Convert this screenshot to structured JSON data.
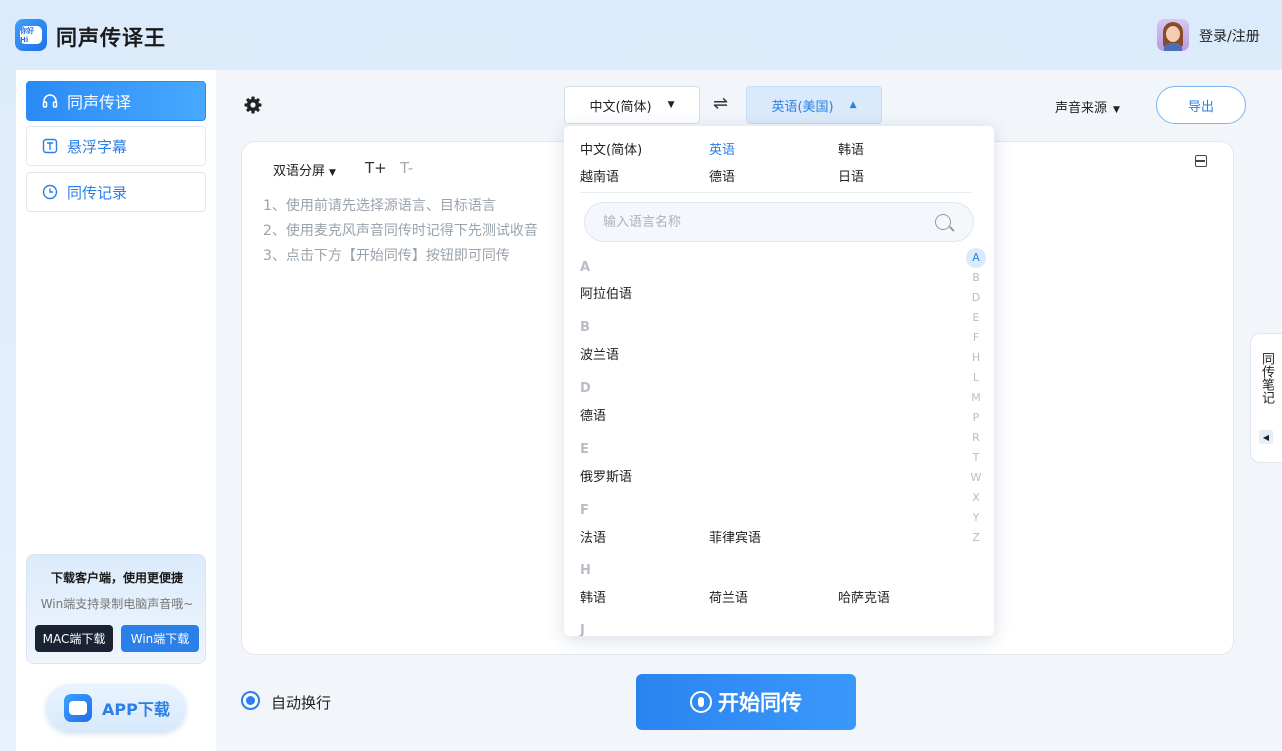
{
  "header": {
    "logo_text": "你好Hi",
    "app_title": "同声传译王",
    "login_label": "登录/注册"
  },
  "sidebar": {
    "items": [
      {
        "label": "同声传译",
        "icon": "headphones-icon",
        "active": true
      },
      {
        "label": "悬浮字幕",
        "icon": "text-box-icon",
        "active": false
      },
      {
        "label": "同传记录",
        "icon": "clock-icon",
        "active": false
      }
    ],
    "promo": {
      "title": "下载客户端，使用更便捷",
      "subtitle": "Win端支持录制电脑声音哦~",
      "mac_button": "MAC端下载",
      "win_button": "Win端下载"
    },
    "app_download_label": "APP下载"
  },
  "toolbar": {
    "source_language": "中文(简体)",
    "target_language": "英语(美国)",
    "voice_source_label": "声音来源",
    "export_label": "导出"
  },
  "panel": {
    "display_mode": "双语分屏",
    "font_increase": "T+",
    "font_decrease": "T-",
    "tips": [
      "1、使用前请先选择源语言、目标语言",
      "2、使用麦克风声音同传时记得下先测试收音",
      "3、点击下方【开始同传】按钮即可同传"
    ]
  },
  "side_notes": {
    "label": "同传笔记"
  },
  "bottom": {
    "auto_wrap_label": "自动换行",
    "auto_wrap_checked": true,
    "start_label": "开始同传"
  },
  "dropdown": {
    "common_languages": [
      {
        "label": "中文(简体)",
        "selected": false
      },
      {
        "label": "英语",
        "selected": true
      },
      {
        "label": "韩语",
        "selected": false
      },
      {
        "label": "越南语",
        "selected": false
      },
      {
        "label": "德语",
        "selected": false
      },
      {
        "label": "日语",
        "selected": false
      }
    ],
    "search_placeholder": "输入语言名称",
    "groups": [
      {
        "letter": "A",
        "languages": [
          "阿拉伯语"
        ]
      },
      {
        "letter": "B",
        "languages": [
          "波兰语"
        ]
      },
      {
        "letter": "D",
        "languages": [
          "德语"
        ]
      },
      {
        "letter": "E",
        "languages": [
          "俄罗斯语"
        ]
      },
      {
        "letter": "F",
        "languages": [
          "法语",
          "菲律宾语"
        ]
      },
      {
        "letter": "H",
        "languages": [
          "韩语",
          "荷兰语",
          "哈萨克语"
        ]
      },
      {
        "letter": "J",
        "languages": []
      }
    ],
    "az_index": [
      "A",
      "B",
      "D",
      "E",
      "F",
      "H",
      "L",
      "M",
      "P",
      "R",
      "T",
      "W",
      "X",
      "Y",
      "Z"
    ],
    "az_active": "A"
  },
  "colors": {
    "accent": "#2a7fe8",
    "background": "#dcebfb",
    "dark_button": "#1a2233"
  }
}
